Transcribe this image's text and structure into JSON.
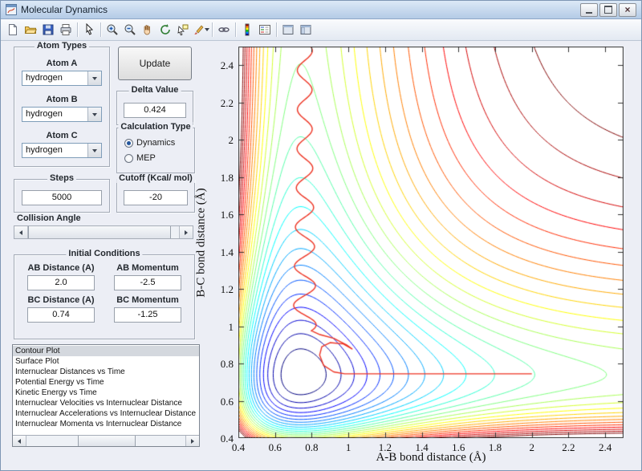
{
  "window": {
    "title": "Molecular Dynamics"
  },
  "toolbar": {
    "icons": [
      "new-figure",
      "open-file",
      "save-figure",
      "print-figure",
      "edit-plot",
      "zoom-in",
      "zoom-out",
      "pan",
      "rotate-3d",
      "data-cursor",
      "brush",
      "link-plot",
      "insert-colorbar",
      "insert-legend",
      "hide-plot-tools",
      "show-plot-tools"
    ]
  },
  "controls": {
    "atom_types": {
      "title": "Atom Types",
      "rows": [
        {
          "label": "Atom A",
          "value": "hydrogen"
        },
        {
          "label": "Atom B",
          "value": "hydrogen"
        },
        {
          "label": "Atom C",
          "value": "hydrogen"
        }
      ]
    },
    "update": {
      "label": "Update"
    },
    "delta": {
      "title": "Delta Value",
      "value": "0.424"
    },
    "calculation": {
      "title": "Calculation Type",
      "options": [
        {
          "label": "Dynamics",
          "selected": true
        },
        {
          "label": "MEP",
          "selected": false
        }
      ]
    },
    "steps": {
      "title": "Steps",
      "value": "5000"
    },
    "cutoff": {
      "title": "Cutoff (Kcal/ mol)",
      "value": "-20"
    },
    "collision_angle": {
      "label": "Collision Angle"
    },
    "initial_conditions": {
      "title": "Initial Conditions",
      "fields": [
        {
          "label": "AB Distance (A)",
          "value": "2.0"
        },
        {
          "label": "AB Momentum",
          "value": "-2.5"
        },
        {
          "label": "BC Distance (A)",
          "value": "0.74"
        },
        {
          "label": "BC Momentum",
          "value": "-1.25"
        }
      ]
    },
    "plot_list": {
      "items": [
        "Contour Plot",
        "Surface Plot",
        "Internuclear Distances vs Time",
        "Potential Energy vs Time",
        "Kinetic Energy vs Time",
        "Internuclear Velocities vs Internuclear Distance",
        "Internuclear Accelerations vs Internuclear Distance",
        "Internuclear Momenta vs Internuclear Distance"
      ],
      "selected_index": 0
    }
  },
  "chart_data": {
    "type": "contour",
    "xlabel": "A-B bond distance (Å)",
    "ylabel": "B-C bond distance (Å)",
    "xlim": [
      0.4,
      2.5
    ],
    "ylim": [
      0.4,
      2.5
    ],
    "xtick_labels": [
      "0.4",
      "0.6",
      "0.8",
      "1",
      "1.2",
      "1.4",
      "1.6",
      "1.8",
      "2",
      "2.2",
      "2.4"
    ],
    "ytick_labels": [
      "0.4",
      "0.6",
      "0.8",
      "1",
      "1.2",
      "1.4",
      "1.6",
      "1.8",
      "2",
      "2.2",
      "2.4"
    ],
    "colormap": "jet",
    "potential": {
      "model": "sum-of-morse",
      "D": 109.5,
      "a": 2.1,
      "r0": 0.74,
      "grid": 200
    },
    "levels": {
      "start": -212,
      "step": 8,
      "count": 25
    },
    "trajectory": {
      "color": "#ee3322",
      "entry": {
        "y": 0.745,
        "x_from": 2.0,
        "x_to": 0.98
      },
      "turn": [
        [
          0.92,
          0.755
        ],
        [
          0.865,
          0.79
        ],
        [
          0.843,
          0.845
        ],
        [
          0.855,
          0.89
        ],
        [
          0.9,
          0.912
        ],
        [
          0.972,
          0.905
        ],
        [
          1.02,
          0.878
        ],
        [
          0.99,
          0.9
        ],
        [
          0.92,
          0.935
        ],
        [
          0.845,
          0.955
        ],
        [
          0.8,
          0.975
        ]
      ],
      "vibration": {
        "x_center": 0.762,
        "amplitude": 0.052,
        "amp_mod": 0.012,
        "y_from": 0.975,
        "y_to": 2.52,
        "period": 0.21,
        "phase": 0.6
      }
    }
  }
}
